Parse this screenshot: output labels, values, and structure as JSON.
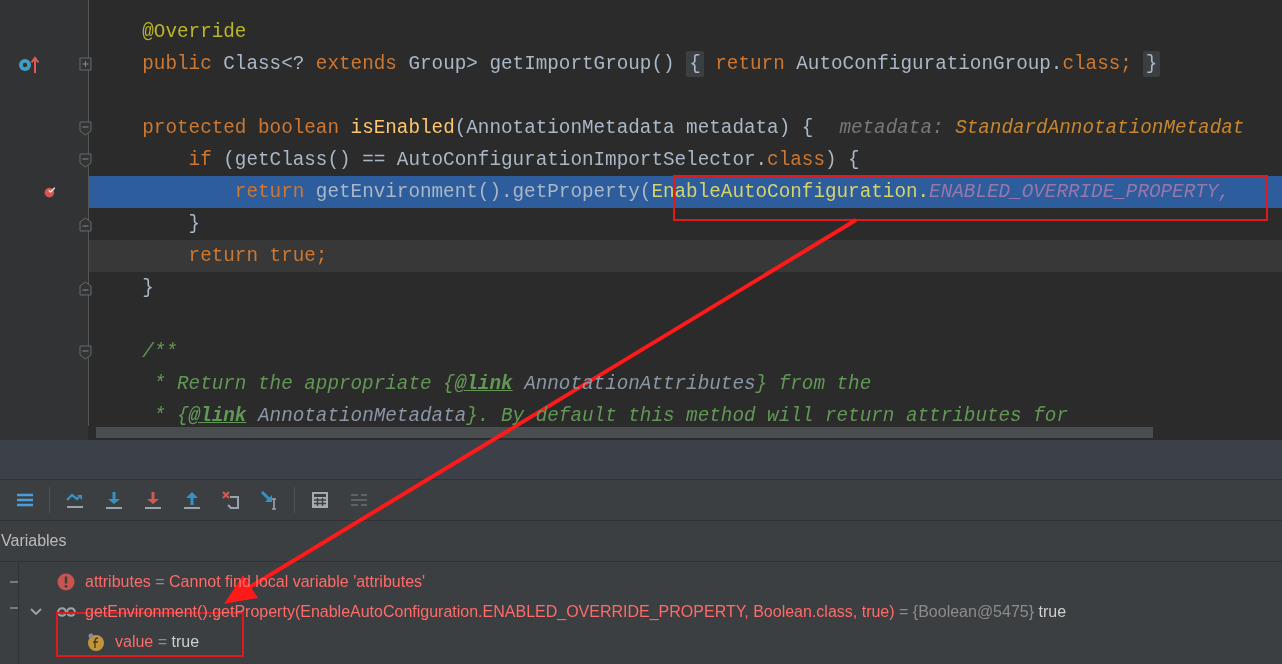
{
  "editor": {
    "lines": [
      {
        "execution_point": false,
        "caret_line": false
      },
      {
        "execution_point": false,
        "caret_line": false,
        "code": [
          {
            "text": "    @Override",
            "kind": "annotation"
          }
        ]
      },
      {
        "execution_point": false,
        "caret_line": false,
        "marker": {
          "kind": "override"
        },
        "fold": {
          "kind": "collapsed"
        },
        "code": [
          {
            "text": "    public ",
            "kind": "keyword"
          },
          {
            "text": "Class<? ",
            "kind": "plain"
          },
          {
            "text": "extends ",
            "kind": "keyword"
          },
          {
            "text": "Group> getImportGroup() ",
            "kind": "plain"
          },
          {
            "text": "{",
            "kind": "folded"
          },
          {
            "text": " return ",
            "kind": "keyword"
          },
          {
            "text": "AutoConfigurationGroup.",
            "kind": "plain"
          },
          {
            "text": "class;",
            "kind": "keyword"
          },
          {
            "text": "}",
            "kind": "folded"
          }
        ]
      },
      {
        "execution_point": false,
        "caret_line": false
      },
      {
        "execution_point": false,
        "caret_line": false,
        "fold": {
          "kind": "open"
        },
        "code": [
          {
            "text": "    protected boolean ",
            "kind": "keyword"
          },
          {
            "text": "isEnabled",
            "kind": "method"
          },
          {
            "text": "(AnnotationMetadata metadata) {",
            "kind": "plain"
          }
        ],
        "hint": [
          {
            "text": "metadata: ",
            "kind": "hint"
          },
          {
            "text": "StandardAnnotationMetadat",
            "kind": "hint-type"
          }
        ]
      },
      {
        "execution_point": false,
        "caret_line": false,
        "fold": {
          "kind": "open"
        },
        "code": [
          {
            "text": "        if ",
            "kind": "keyword"
          },
          {
            "text": "(getClass() == AutoConfigurationImportSelector.",
            "kind": "plain"
          },
          {
            "text": "class",
            "kind": "keyword"
          },
          {
            "text": ") {",
            "kind": "plain"
          }
        ]
      },
      {
        "execution_point": true,
        "caret_line": false,
        "marker": {
          "kind": "breakpoint"
        },
        "code": [
          {
            "text": "            return ",
            "kind": "keyword"
          },
          {
            "text": "getEnvironment().getProperty(",
            "kind": "plain"
          },
          {
            "text": "EnableAutoConfiguration.",
            "kind": "match"
          },
          {
            "text": "ENABLED_OVERRIDE_PROPERTY,",
            "kind": "constant"
          }
        ]
      },
      {
        "execution_point": false,
        "caret_line": false,
        "fold": {
          "kind": "end"
        },
        "code": [
          {
            "text": "        }",
            "kind": "plain"
          }
        ]
      },
      {
        "execution_point": false,
        "caret_line": true,
        "code": [
          {
            "text": "        return true;",
            "kind": "keyword"
          }
        ]
      },
      {
        "execution_point": false,
        "caret_line": false,
        "fold": {
          "kind": "end"
        },
        "code": [
          {
            "text": "    }",
            "kind": "plain"
          }
        ]
      },
      {
        "execution_point": false,
        "caret_line": false
      },
      {
        "execution_point": false,
        "caret_line": false,
        "fold": {
          "kind": "open"
        },
        "code": [
          {
            "text": "    /**",
            "kind": "comment"
          }
        ]
      },
      {
        "execution_point": false,
        "caret_line": false,
        "code": [
          {
            "text": "     * Return the appropriate {",
            "kind": "comment"
          },
          {
            "text": "@link",
            "kind": "doc-tag"
          },
          {
            "text": " AnnotationAttributes",
            "kind": "doc-ref"
          },
          {
            "text": "} from the",
            "kind": "comment"
          }
        ]
      },
      {
        "execution_point": false,
        "caret_line": false,
        "code": [
          {
            "text": "     * {",
            "kind": "comment"
          },
          {
            "text": "@link",
            "kind": "doc-tag"
          },
          {
            "text": " AnnotationMetadata",
            "kind": "doc-ref"
          },
          {
            "text": "}. By default this method will return attributes for",
            "kind": "comment"
          }
        ]
      }
    ]
  },
  "debug_toolbar": {
    "groups": [
      [
        {
          "kind": "layout",
          "disabled": false
        }
      ],
      [
        {
          "kind": "step-over",
          "disabled": false
        },
        {
          "kind": "step-into",
          "disabled": false
        },
        {
          "kind": "force-step-into",
          "disabled": false
        },
        {
          "kind": "step-out",
          "disabled": false
        },
        {
          "kind": "drop-frame",
          "disabled": false
        },
        {
          "kind": "run-to-cursor",
          "disabled": false
        }
      ],
      [
        {
          "kind": "evaluate",
          "disabled": false
        },
        {
          "kind": "trace",
          "disabled": true
        }
      ]
    ]
  },
  "variables": {
    "title": "Variables",
    "rows": [
      {
        "kind": "error",
        "name": "attributes",
        "separator": "=",
        "value": "Cannot find local variable 'attributes'"
      },
      {
        "kind": "watch",
        "expanded": true,
        "name": "getEnvironment().getProperty(EnableAutoConfiguration.ENABLED_OVERRIDE_PROPERTY, Boolean.class, true)",
        "separator": "=",
        "type_ref": "{Boolean@5475}",
        "value": "true",
        "children": [
          {
            "kind": "field",
            "name": "value",
            "separator": "=",
            "value": "true"
          }
        ]
      }
    ]
  }
}
